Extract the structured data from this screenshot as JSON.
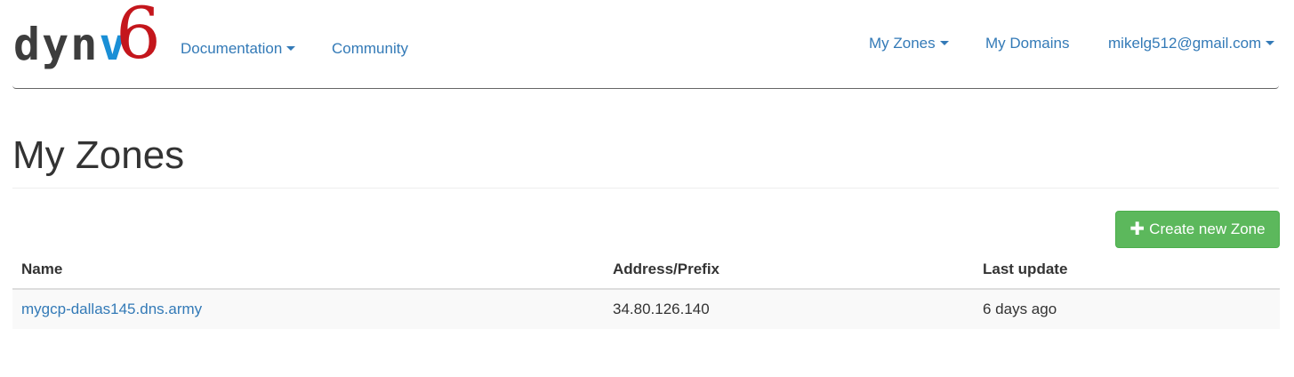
{
  "brand": {
    "logo_text": "dynv6",
    "logo_parts": {
      "prefix": "dyn",
      "v": "v",
      "six": "6"
    },
    "colors": {
      "dark": "#3d3d3d",
      "v": "#1a8fd6",
      "six": "#c4161c"
    }
  },
  "nav": {
    "documentation": "Documentation",
    "community": "Community",
    "my_zones": "My Zones",
    "my_domains": "My Domains",
    "user": "mikelg512@gmail.com"
  },
  "page": {
    "title": "My Zones",
    "create_button": "Create new Zone"
  },
  "table": {
    "headers": [
      "Name",
      "Address/Prefix",
      "Last update"
    ],
    "rows": [
      {
        "name": "mygcp-dallas145.dns.army",
        "address": "34.80.126.140",
        "updated": "6 days ago"
      }
    ]
  },
  "colors": {
    "link": "#337ab7",
    "success": "#5cb85c"
  },
  "icons": {
    "caret": "caret-down-icon",
    "plus": "plus-icon"
  }
}
